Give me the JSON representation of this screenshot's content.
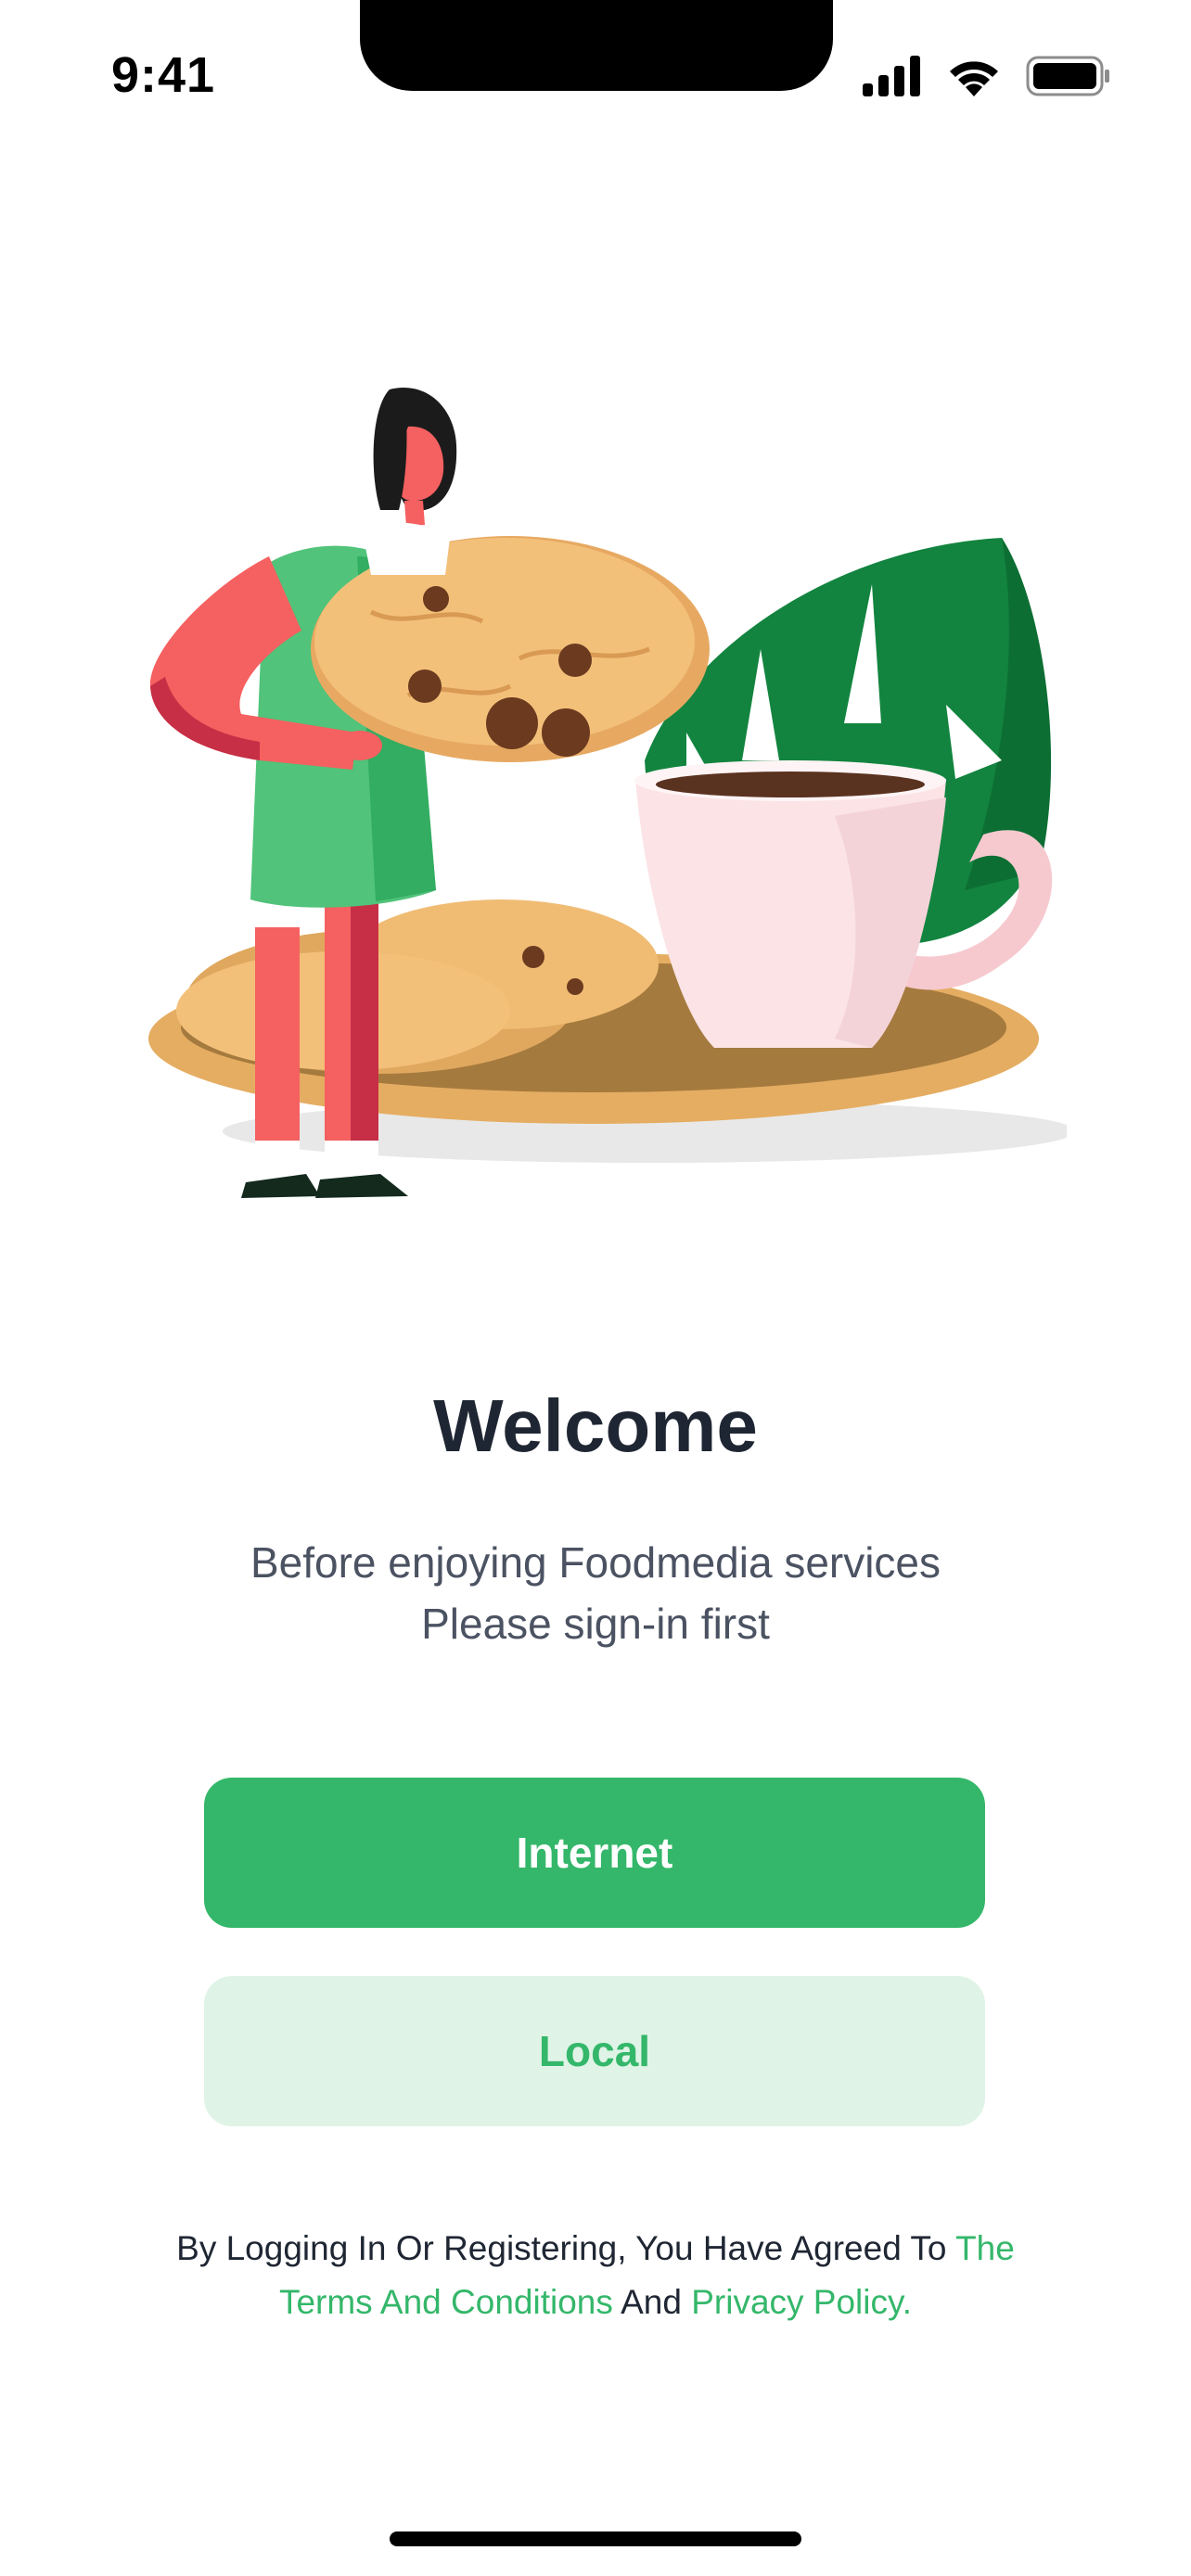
{
  "status_bar": {
    "time": "9:41",
    "icons": [
      "cellular-signal-icon",
      "wifi-icon",
      "battery-icon"
    ]
  },
  "hero": {
    "illustration": "woman-holding-cookie-with-coffee-illustration"
  },
  "welcome": {
    "title": "Welcome",
    "subtitle_line1": "Before enjoying Foodmedia services",
    "subtitle_line2": "Please sign-in first"
  },
  "buttons": {
    "internet_label": "Internet",
    "local_label": "Local"
  },
  "legal": {
    "prefix": "By Logging In Or Registering, You Have Agreed To ",
    "terms_link": "The Terms And Conditions",
    "joiner": " And ",
    "privacy_link": "Privacy Policy."
  },
  "colors": {
    "accent": "#34b76a",
    "accent_light": "#dff4e6",
    "text_dark": "#1f2633",
    "text_muted": "#4b5262"
  }
}
